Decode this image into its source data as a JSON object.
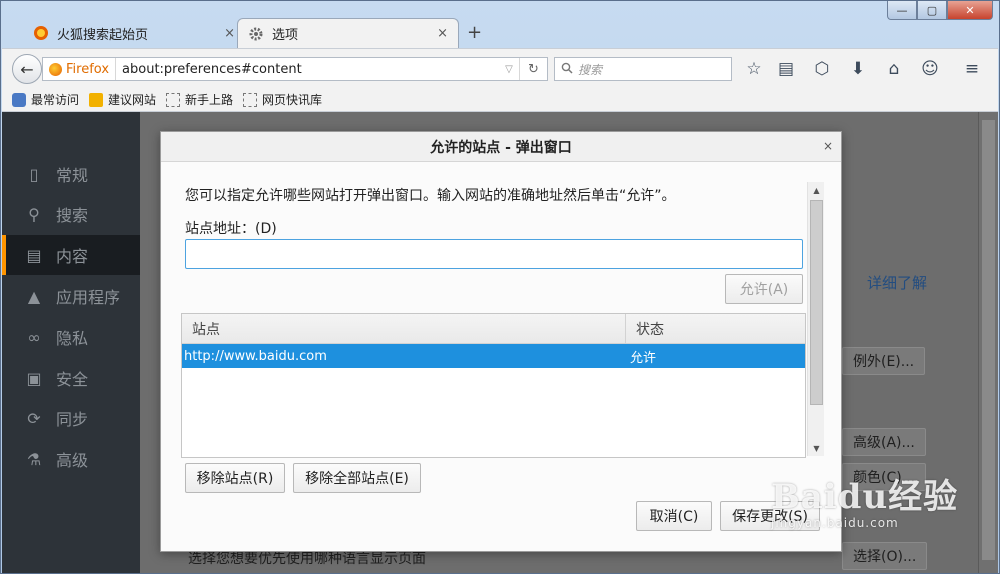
{
  "window": {
    "minimize_label": "—",
    "maximize_label": "▢",
    "close_label": "✕"
  },
  "tabs": [
    {
      "label": "火狐搜索起始页",
      "close": "×"
    },
    {
      "label": "选项",
      "close": "×"
    }
  ],
  "new_tab_label": "+",
  "navbar": {
    "back_icon": "←",
    "identity_label": "Firefox",
    "url": "about:preferences#content",
    "dropdown_icon": "▽",
    "reload_icon": "↻",
    "search_placeholder": "搜索",
    "search_icon": "🔍",
    "toolbar_icons": [
      "☆",
      "▤",
      "⬡",
      "⬇",
      "⌂",
      "☺",
      "≡"
    ]
  },
  "bookmarks": [
    {
      "label": "最常访问"
    },
    {
      "label": "建议网站"
    },
    {
      "label": "新手上路"
    },
    {
      "label": "网页快讯库"
    }
  ],
  "sidebar": {
    "items": [
      {
        "label": "常规",
        "icon": "▯"
      },
      {
        "label": "搜索",
        "icon": "⚲"
      },
      {
        "label": "内容",
        "icon": "▤",
        "selected": true
      },
      {
        "label": "应用程序",
        "icon": "▲"
      },
      {
        "label": "隐私",
        "icon": "∞"
      },
      {
        "label": "安全",
        "icon": "▣"
      },
      {
        "label": "同步",
        "icon": "⟳"
      },
      {
        "label": "高级",
        "icon": "⚗"
      }
    ]
  },
  "background": {
    "learn_more": "详细了解",
    "exceptions_button": "例外(E)...",
    "advanced_button": "高级(A)...",
    "colors_button": "颜色(C)...",
    "choose_button": "选择(O)...",
    "language_text": "选择您想要优先使用哪种语言显示页面"
  },
  "dialog": {
    "title": "允许的站点 - 弹出窗口",
    "close_icon": "×",
    "description": "您可以指定允许哪些网站打开弹出窗口。输入网站的准确地址然后单击“允许”。",
    "address_label": "站点地址：(D)",
    "address_value": "",
    "allow_button": "允许(A)",
    "table": {
      "columns": [
        "站点",
        "状态"
      ],
      "rows": [
        {
          "site": "http://www.baidu.com",
          "status": "允许"
        }
      ]
    },
    "remove_site_button": "移除站点(R)",
    "remove_all_button": "移除全部站点(E)",
    "cancel_button": "取消(C)",
    "save_button": "保存更改(S)"
  },
  "watermark": {
    "main": "Baidu经验",
    "sub": "jingyan.baidu.com"
  }
}
